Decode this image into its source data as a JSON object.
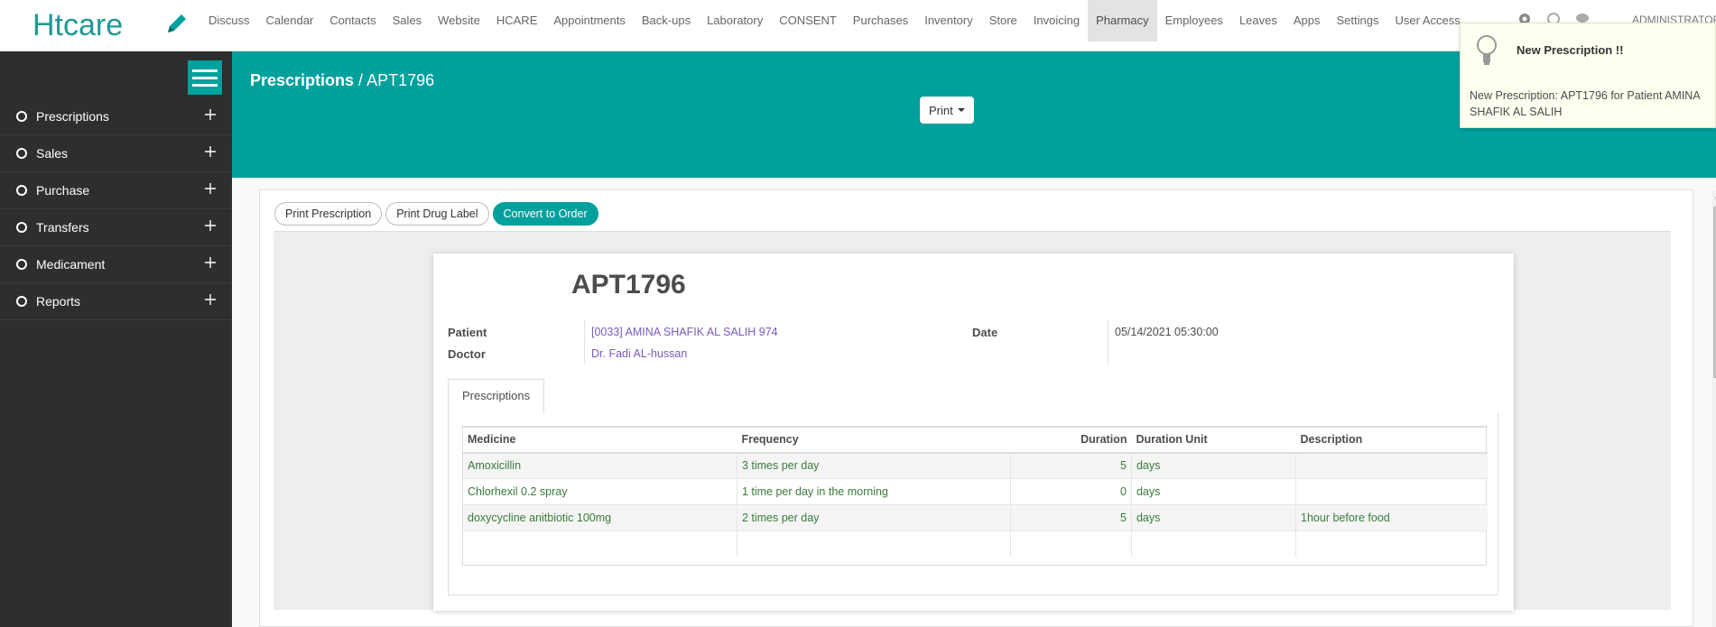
{
  "app": {
    "logo_text": "Htcare"
  },
  "nav": {
    "items": [
      "Discuss",
      "Calendar",
      "Contacts",
      "Sales",
      "Website",
      "HCARE",
      "Appointments",
      "Back-ups",
      "Laboratory",
      "CONSENT",
      "Purchases",
      "Inventory",
      "Store",
      "Invoicing",
      "Pharmacy",
      "Employees",
      "Leaves",
      "Apps",
      "Settings",
      "User Access"
    ],
    "active": "Pharmacy",
    "user": "ADMINISTRATOR"
  },
  "sidebar": {
    "items": [
      {
        "label": "Prescriptions"
      },
      {
        "label": "Sales"
      },
      {
        "label": "Purchase"
      },
      {
        "label": "Transfers"
      },
      {
        "label": "Medicament"
      },
      {
        "label": "Reports"
      }
    ]
  },
  "control_panel": {
    "breadcrumb_parent": "Prescriptions",
    "breadcrumb_sep": " / ",
    "breadcrumb_current": "APT1796",
    "print_label": "Print"
  },
  "notification": {
    "title": "New Prescription !!",
    "body": "New Prescription: APT1796 for Patient AMINA SHAFIK AL SALIH"
  },
  "statusbar": {
    "print_prescription": "Print Prescription",
    "print_drug_label": "Print Drug Label",
    "convert_to_order": "Convert to Order"
  },
  "record": {
    "name": "APT1796",
    "patient_label": "Patient",
    "patient_value": "[0033] AMINA SHAFIK AL SALIH 974",
    "doctor_label": "Doctor",
    "doctor_value": "Dr. Fadi AL-hussan",
    "date_label": "Date",
    "date_value": "05/14/2021 05:30:00"
  },
  "tabs": {
    "prescriptions": "Prescriptions"
  },
  "lines": {
    "columns": [
      "Medicine",
      "Frequency",
      "Duration",
      "Duration Unit",
      "Description"
    ],
    "rows": [
      {
        "medicine": "Amoxicillin",
        "frequency": "3 times per day",
        "duration": "5",
        "unit": "days",
        "description": ""
      },
      {
        "medicine": "Chlorhexil 0.2 spray",
        "frequency": "1 time per day in the morning",
        "duration": "0",
        "unit": "days",
        "description": ""
      },
      {
        "medicine": "doxycycline anitbiotic 100mg",
        "frequency": "2 times per day",
        "duration": "5",
        "unit": "days",
        "description": "1hour before food"
      }
    ]
  },
  "colors": {
    "brand": "#00a09d",
    "sidebar": "#2e2e2e",
    "link": "#7c5bbb",
    "line_text": "#3a7a3a"
  },
  "icons": {
    "edit": "pencil-icon",
    "settings": "gear-icon",
    "activity": "clock-icon",
    "chat": "chat-icon",
    "notification": "lightbulb-icon",
    "menu": "hamburger-icon",
    "expand": "plus-icon"
  }
}
